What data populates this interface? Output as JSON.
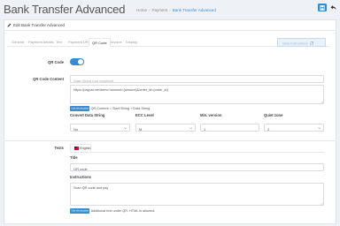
{
  "header": {
    "title": "Bank Transfer Advanced",
    "breadcrumb": [
      "Home",
      "Payment",
      "Bank Transfer Advanced"
    ]
  },
  "panel": {
    "title": "Edit Bank Transfer Advanced"
  },
  "tabs": [
    "General",
    "Payment details",
    "Text",
    "Payment URL",
    "QR Code",
    "Invoice",
    "Display"
  ],
  "active_tab": "QR Code",
  "preview_button": "View Instructions",
  "qr_code": {
    "label": "QR Code",
    "enabled": true
  },
  "qr_content": {
    "label": "QR Code Content",
    "start_placeholder": "Start String (not required)",
    "data_value": "https://paypal.me/demo?amount={amount}&order_id={order_id}",
    "help_badge": "Use shortcodes",
    "help_text": "QR Content = Start String + Data String"
  },
  "options": {
    "convert": {
      "label": "Convert Data String",
      "value": "No"
    },
    "ecc": {
      "label": "ECC Level",
      "value": "M"
    },
    "min_version": {
      "label": "Min. version",
      "value": "1"
    },
    "quiet_zone": {
      "label": "Quiet zone",
      "value": "2"
    }
  },
  "texts": {
    "label": "Texts",
    "language": "English",
    "title_label": "Title",
    "title_value": "QR code",
    "instructions_label": "Instructions",
    "instructions_value": "Scan QR code and pay",
    "help_badge": "Use shortcodes",
    "help_text": "Additional text under QR. HTML is allowed."
  },
  "colors": {
    "accent": "#2f8cd8",
    "link": "#3a8ed0"
  }
}
